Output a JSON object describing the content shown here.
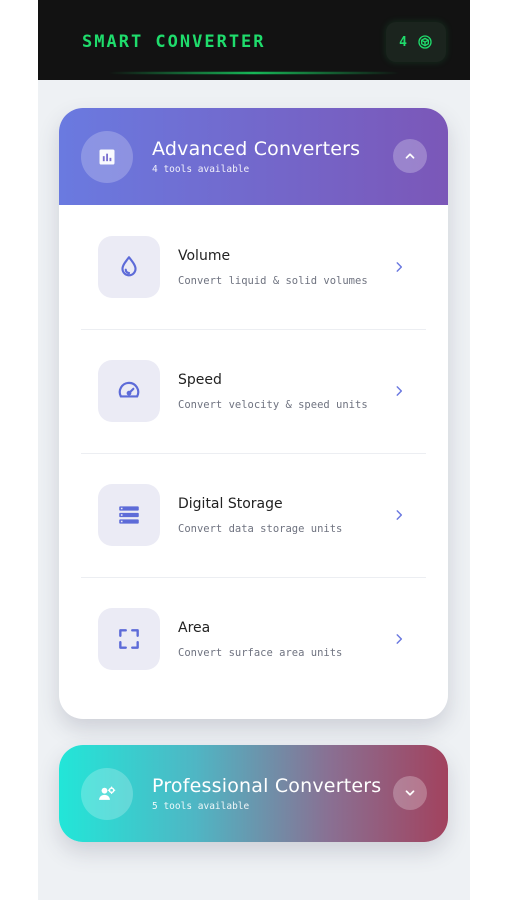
{
  "app": {
    "title": "SMART CONVERTER",
    "counter": "4",
    "accent_color": "#1fdc6c",
    "counter_icon": "cube-icon"
  },
  "advanced": {
    "title": "Advanced Converters",
    "subtitle": "4 tools available",
    "icon": "chart-icon",
    "toggle_icon": "chevron-up-icon",
    "expanded": true,
    "tools": [
      {
        "name": "Volume",
        "description": "Convert liquid & solid volumes",
        "icon": "droplet-icon"
      },
      {
        "name": "Speed",
        "description": "Convert velocity & speed units",
        "icon": "speedometer-icon"
      },
      {
        "name": "Digital Storage",
        "description": "Convert data storage units",
        "icon": "storage-icon"
      },
      {
        "name": "Area",
        "description": "Convert surface area units",
        "icon": "area-frame-icon"
      }
    ]
  },
  "professional": {
    "title": "Professional Converters",
    "subtitle": "5 tools available",
    "icon": "user-gear-icon",
    "toggle_icon": "chevron-down-icon",
    "expanded": false
  }
}
